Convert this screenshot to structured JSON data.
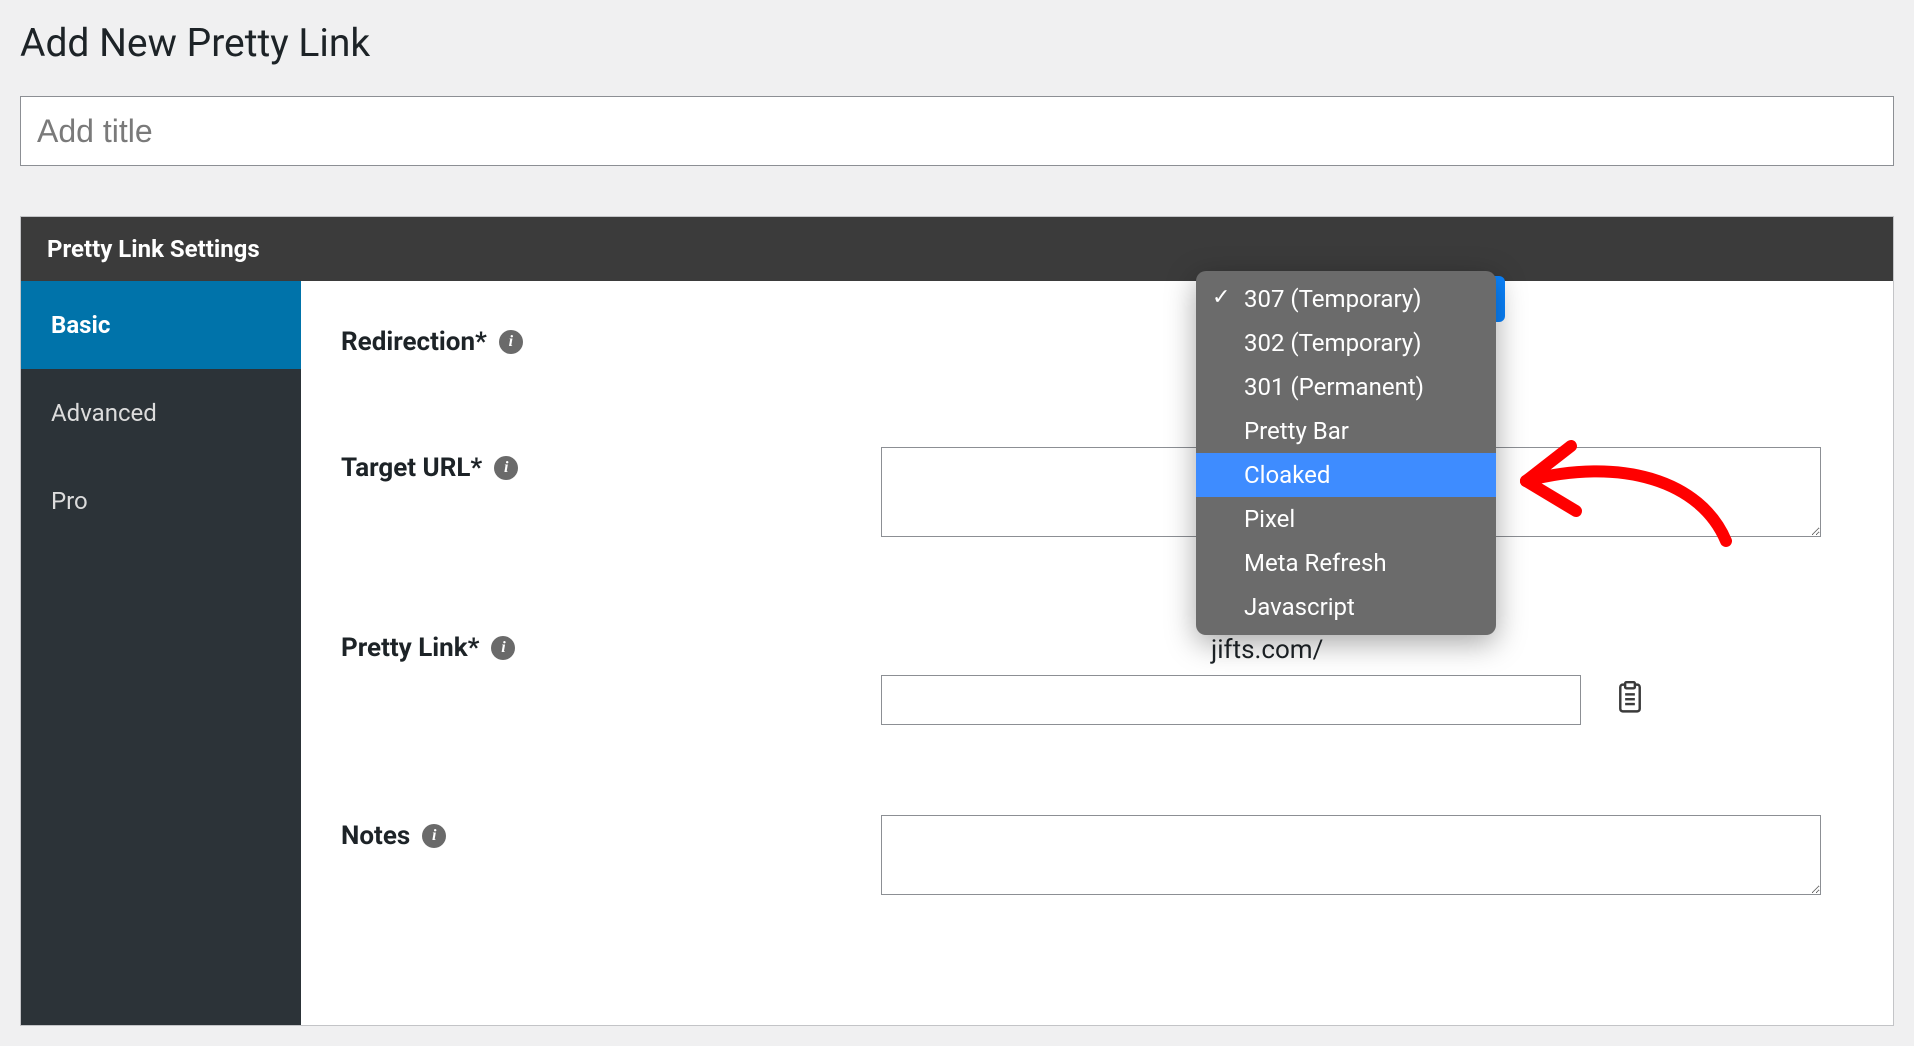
{
  "header": {
    "title": "Add New Pretty Link"
  },
  "title_field": {
    "placeholder": "Add title",
    "value": ""
  },
  "panel": {
    "title": "Pretty Link Settings",
    "tabs": [
      {
        "label": "Basic",
        "active": true
      },
      {
        "label": "Advanced",
        "active": false
      },
      {
        "label": "Pro",
        "active": false
      }
    ]
  },
  "form": {
    "redirection": {
      "label": "Redirection*",
      "info_label": "i",
      "options": [
        {
          "label": "307 (Temporary)",
          "selected": true,
          "highlight": false
        },
        {
          "label": "302 (Temporary)",
          "selected": false,
          "highlight": false
        },
        {
          "label": "301 (Permanent)",
          "selected": false,
          "highlight": false
        },
        {
          "label": "Pretty Bar",
          "selected": false,
          "highlight": false
        },
        {
          "label": "Cloaked",
          "selected": false,
          "highlight": true
        },
        {
          "label": "Pixel",
          "selected": false,
          "highlight": false
        },
        {
          "label": "Meta Refresh",
          "selected": false,
          "highlight": false
        },
        {
          "label": "Javascript",
          "selected": false,
          "highlight": false
        }
      ]
    },
    "target_url": {
      "label": "Target URL*",
      "info_label": "i",
      "value": ""
    },
    "pretty_link": {
      "label": "Pretty Link*",
      "info_label": "i",
      "prefix_visible": "jifts.com/",
      "slug_value": ""
    },
    "notes": {
      "label": "Notes",
      "info_label": "i",
      "value": ""
    }
  },
  "colors": {
    "accent": "#0073aa",
    "highlight": "#3e8cff",
    "annotation": "#ff0000"
  }
}
